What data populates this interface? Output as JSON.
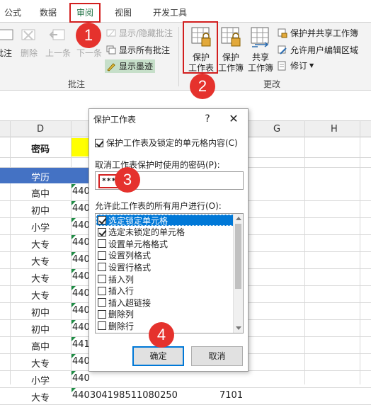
{
  "tabs": [
    "公式",
    "数据",
    "审阅",
    "视图",
    "开发工具"
  ],
  "active_tab": "审阅",
  "ribbon": {
    "left_partial_labels": [
      "批注",
      "删除",
      "上一条",
      "下一条"
    ],
    "comment_commands": [
      "显示/隐藏批注",
      "显示所有批注",
      "显示墨迹"
    ],
    "comments_group": "批注",
    "protect_sheet": [
      "保护",
      "工作表"
    ],
    "protect_workbook": [
      "保护",
      "工作簿"
    ],
    "share_workbook": [
      "共享",
      "工作簿"
    ],
    "changes_commands": [
      "保护并共享工作簿",
      "允许用户编辑区域",
      "修订"
    ],
    "changes_group": "更改"
  },
  "sheet": {
    "columns": [
      "D",
      "G",
      "H"
    ],
    "header_label": "密码",
    "table_header": "学历",
    "rows": [
      {
        "edu": "高中",
        "id": "440"
      },
      {
        "edu": "初中",
        "id": "440"
      },
      {
        "edu": "小学",
        "id": "440"
      },
      {
        "edu": "大专",
        "id": "440"
      },
      {
        "edu": "大专",
        "id": "440"
      },
      {
        "edu": "大专",
        "id": "440"
      },
      {
        "edu": "大专",
        "id": "440"
      },
      {
        "edu": "初中",
        "id": "440"
      },
      {
        "edu": "初中",
        "id": "440"
      },
      {
        "edu": "高中",
        "id": "441"
      },
      {
        "edu": "大专",
        "id": "440"
      },
      {
        "edu": "小学",
        "id": "440"
      },
      {
        "edu": "大专",
        "id": "440304198511080250"
      }
    ],
    "last_row_extra": "7101"
  },
  "dialog": {
    "title": "保护工作表",
    "help": "?",
    "close": "✕",
    "protect_checkbox": "保护工作表及锁定的单元格内容(C)",
    "password_label": "取消工作表保护时使用的密码(P):",
    "password_value": "***",
    "allow_label": "允许此工作表的所有用户进行(O):",
    "options": [
      {
        "label": "选定锁定单元格",
        "checked": true
      },
      {
        "label": "选定未锁定的单元格",
        "checked": true
      },
      {
        "label": "设置单元格格式",
        "checked": false
      },
      {
        "label": "设置列格式",
        "checked": false
      },
      {
        "label": "设置行格式",
        "checked": false
      },
      {
        "label": "插入列",
        "checked": false
      },
      {
        "label": "插入行",
        "checked": false
      },
      {
        "label": "插入超链接",
        "checked": false
      },
      {
        "label": "删除列",
        "checked": false
      },
      {
        "label": "删除行",
        "checked": false
      }
    ],
    "ok": "确定",
    "cancel": "取消"
  },
  "callouts": [
    "1",
    "2",
    "3",
    "4"
  ],
  "colors": {
    "callout": "#e5322d",
    "highlight_box": "#d21f1f",
    "selection": "#0078d7",
    "yellow_cell": "#ffff00",
    "excel_green": "#217346"
  }
}
